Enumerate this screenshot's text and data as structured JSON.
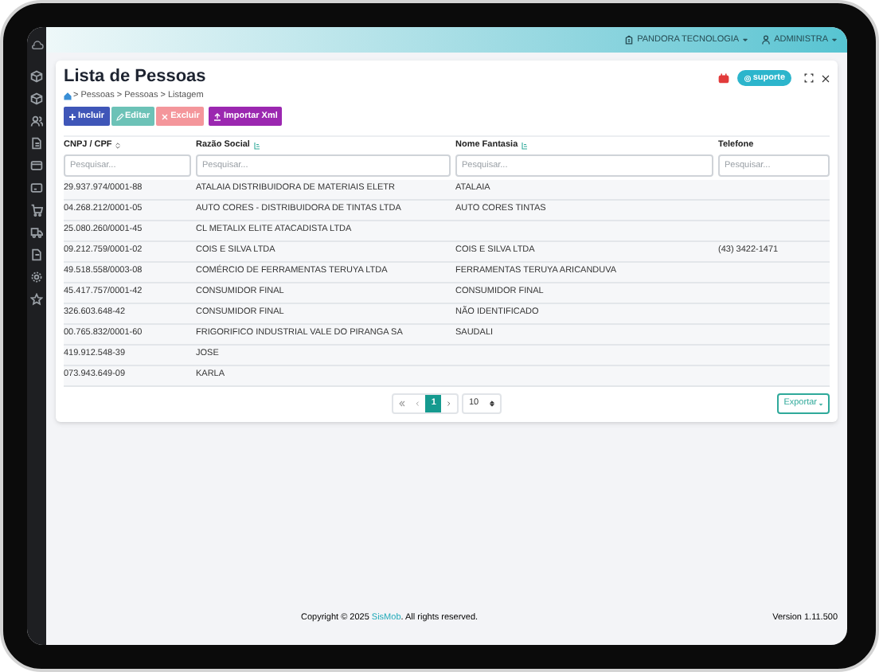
{
  "topbar": {
    "company": "PANDORA TECNOLOGIA",
    "user": "ADMINISTRA"
  },
  "page": {
    "title": "Lista de Pessoas",
    "breadcrumb": "> Pessoas > Pessoas > Listagem",
    "support": "suporte"
  },
  "toolbar": [
    {
      "label": "Incluir",
      "kind": "add",
      "disabled": false
    },
    {
      "label": "Editar",
      "kind": "edit",
      "disabled": true
    },
    {
      "label": "Excluir",
      "kind": "delete",
      "disabled": true
    },
    {
      "label": "Importar Xml",
      "kind": "import",
      "disabled": false
    }
  ],
  "table": {
    "columns": [
      {
        "label": "CNPJ / CPF",
        "kind": "sortable",
        "placeholder": "Pesquisar..."
      },
      {
        "label": "Razão Social",
        "kind": "filterable",
        "placeholder": "Pesquisar..."
      },
      {
        "label": "Nome Fantasia",
        "kind": "filterable",
        "placeholder": "Pesquisar..."
      },
      {
        "label": "Telefone",
        "kind": "plain",
        "placeholder": "Pesquisar..."
      }
    ],
    "rows": [
      {
        "cnpj_cpf": "29.937.974/0001-88",
        "razao_social": "ATALAIA DISTRIBUIDORA DE MATERIAIS ELETR",
        "nome_fantasia": "ATALAIA"
      },
      {
        "cnpj_cpf": "04.268.212/0001-05",
        "razao_social": "AUTO CORES - DISTRIBUIDORA DE TINTAS LTDA",
        "nome_fantasia": "AUTO CORES TINTAS"
      },
      {
        "cnpj_cpf": "25.080.260/0001-45",
        "razao_social": "CL METALIX ELITE ATACADISTA LTDA"
      },
      {
        "cnpj_cpf": "09.212.759/0001-02",
        "razao_social": "COIS E SILVA LTDA",
        "nome_fantasia": "COIS E SILVA LTDA",
        "telefone": "(43) 3422-1471"
      },
      {
        "cnpj_cpf": "49.518.558/0003-08",
        "razao_social": "COMÉRCIO DE FERRAMENTAS TERUYA LTDA",
        "nome_fantasia": "FERRAMENTAS TERUYA ARICANDUVA"
      },
      {
        "cnpj_cpf": "45.417.757/0001-42",
        "razao_social": "CONSUMIDOR FINAL",
        "nome_fantasia": "CONSUMIDOR FINAL"
      },
      {
        "cnpj_cpf": "326.603.648-42",
        "razao_social": "CONSUMIDOR FINAL",
        "nome_fantasia": "NÃO IDENTIFICADO"
      },
      {
        "cnpj_cpf": "00.765.832/0001-60",
        "razao_social": "FRIGORIFICO INDUSTRIAL VALE DO PIRANGA SA",
        "nome_fantasia": "SAUDALI"
      },
      {
        "cnpj_cpf": "419.912.548-39",
        "razao_social": "JOSE"
      },
      {
        "cnpj_cpf": "073.943.649-09",
        "razao_social": "KARLA"
      }
    ]
  },
  "pagination": {
    "pages": [
      {
        "label": "1",
        "selected": true
      }
    ],
    "page_size": "10",
    "export": "Exportar"
  },
  "footer": {
    "copyright": "Copyright © 2025",
    "brand": "SisMob",
    "rights": ". All rights reserved.",
    "version": "Version 1.11.500"
  }
}
